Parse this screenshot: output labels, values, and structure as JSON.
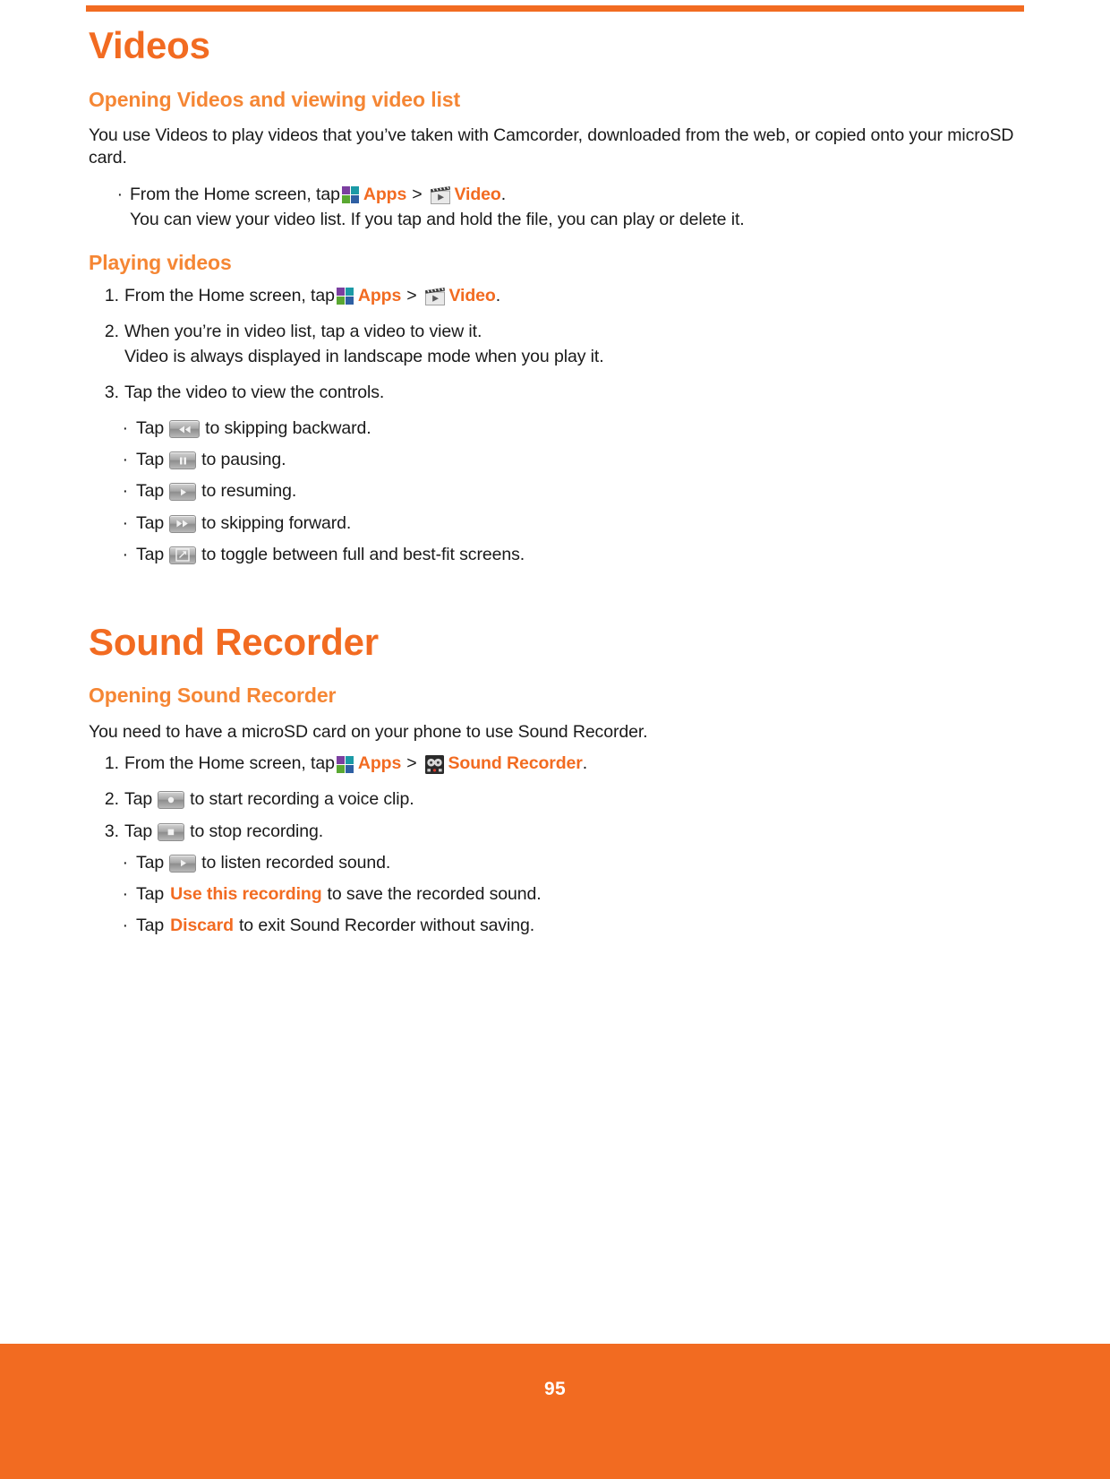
{
  "page": {
    "number": "95",
    "accent_color": "#f26b21",
    "heading_color": "#f58634",
    "body_color": "#1a1a1a"
  },
  "chapters": [
    {
      "title": "Videos",
      "sections": [
        {
          "heading": "Opening Videos and viewing video list",
          "intro": "You use Videos to play videos that you’ve taken with Camcorder, downloaded from the web, or copied onto your microSD card.",
          "items": [
            {
              "marker": "·",
              "pre": "From the Home screen, tap",
              "icon1": "apps-icon",
              "label1": "Apps",
              "sep": ">",
              "icon2": "video-icon",
              "label2": "Video",
              "post": ".",
              "second_line": "You can view your video list. If you tap and hold the file, you can play or delete it."
            }
          ]
        },
        {
          "heading": "Playing videos",
          "items": [
            {
              "marker": "1.",
              "pre": "From the Home screen, tap",
              "icon1": "apps-icon",
              "label1": "Apps",
              "sep": ">",
              "icon2": "video-icon",
              "label2": "Video",
              "post": "."
            },
            {
              "marker": "2.",
              "pre": "When you’re in video list, tap a video to view it.",
              "second_line": "Video is always displayed in landscape mode when you play it."
            },
            {
              "marker": "3.",
              "pre": "Tap the video to view the controls."
            }
          ],
          "subitems": [
            {
              "marker": "·",
              "pre": "Tap",
              "icon": "rewind-icon",
              "post": "to skipping backward."
            },
            {
              "marker": "·",
              "pre": "Tap",
              "icon": "pause-icon",
              "post": "to pausing."
            },
            {
              "marker": "·",
              "pre": "Tap",
              "icon": "play-icon",
              "post": "to resuming."
            },
            {
              "marker": "·",
              "pre": "Tap",
              "icon": "fastforward-icon",
              "post": "to skipping forward."
            },
            {
              "marker": "·",
              "pre": "Tap",
              "icon": "fullscreen-toggle-icon",
              "post": "to toggle between full and best-fit screens."
            }
          ]
        }
      ]
    },
    {
      "title": "Sound Recorder",
      "sections": [
        {
          "heading": "Opening Sound Recorder",
          "intro": "You need to have a microSD card on your phone to use Sound Recorder.",
          "items": [
            {
              "marker": "1.",
              "pre": "From the Home screen, tap",
              "icon1": "apps-icon",
              "label1": "Apps",
              "sep": ">",
              "icon2": "sound-recorder-icon",
              "label2": "Sound Recorder",
              "post": "."
            },
            {
              "marker": "2.",
              "pre": "Tap",
              "icon": "record-icon",
              "post": "to start recording a voice clip."
            },
            {
              "marker": "3.",
              "pre": "Tap",
              "icon": "stop-icon",
              "post": "to stop recording."
            }
          ],
          "subitems": [
            {
              "marker": "·",
              "pre": "Tap",
              "icon": "play-icon",
              "post": "to listen recorded sound."
            },
            {
              "marker": "·",
              "pre": "Tap",
              "emphasis": "Use this recording",
              "post": "to save the recorded sound."
            },
            {
              "marker": "·",
              "pre": "Tap",
              "emphasis": "Discard",
              "post": "to exit Sound Recorder without saving."
            }
          ]
        }
      ]
    }
  ]
}
